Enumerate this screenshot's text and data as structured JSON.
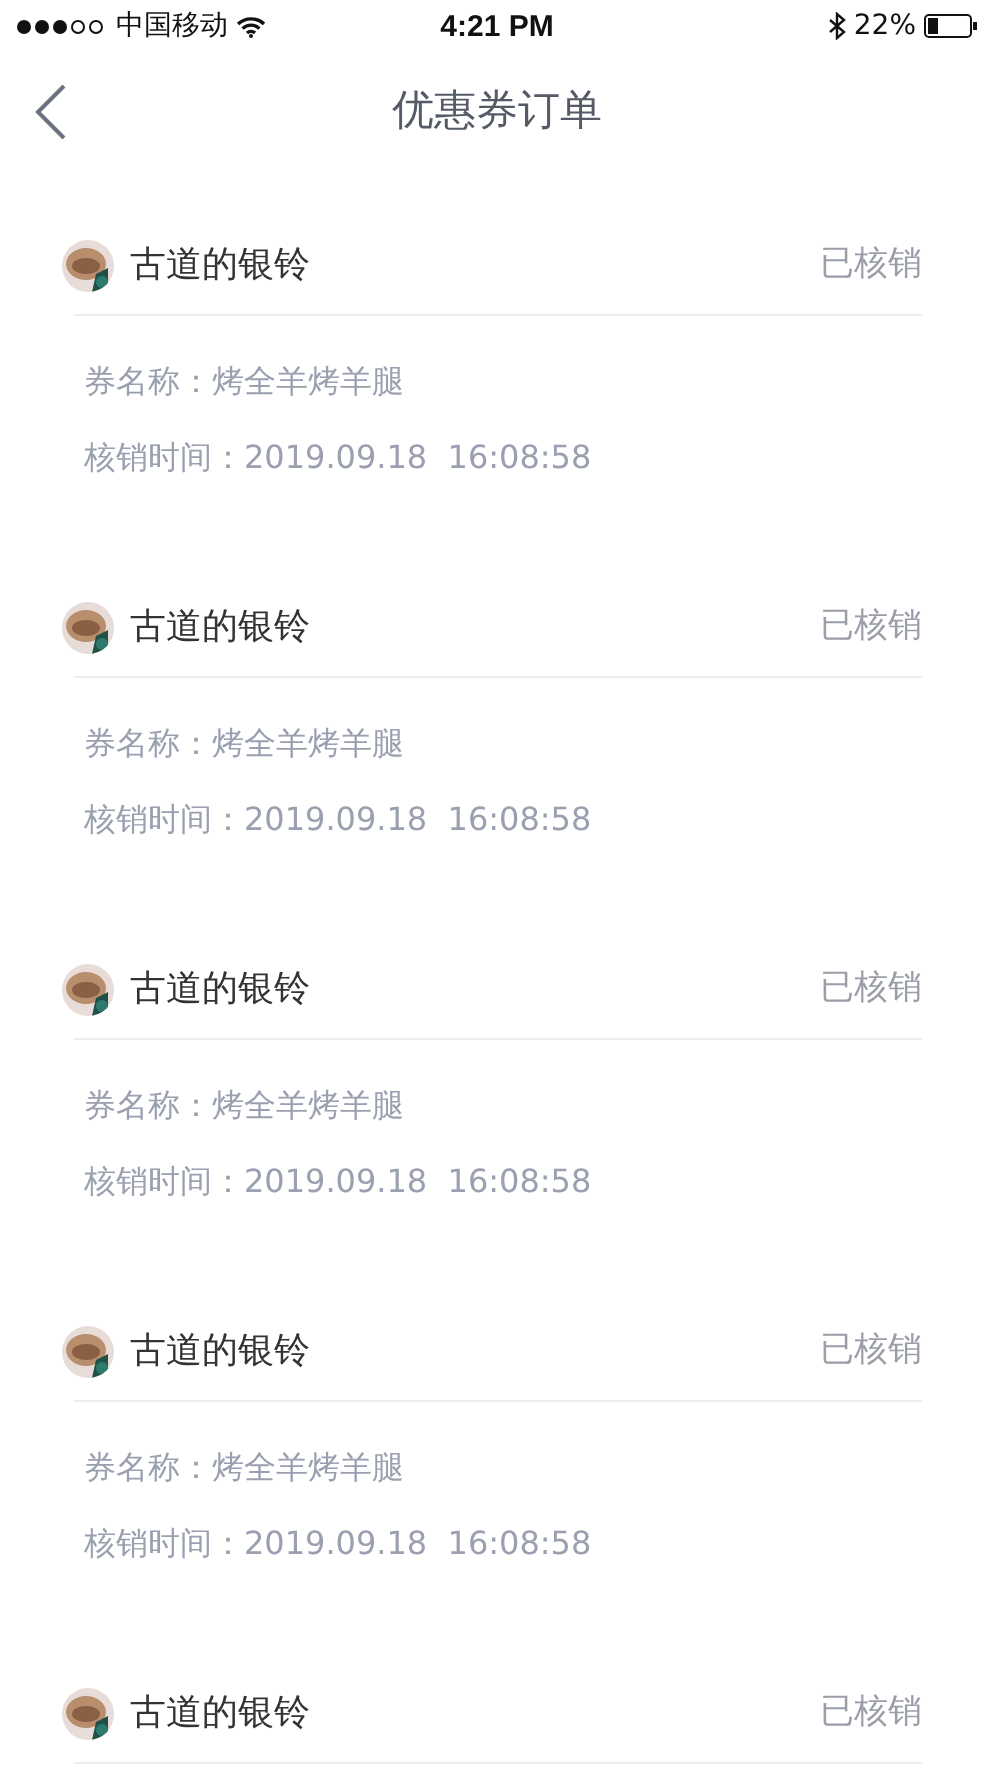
{
  "status_bar": {
    "carrier": "中国移动",
    "time": "4:21 PM",
    "battery_percent": "22%"
  },
  "nav": {
    "title": "优惠券订单"
  },
  "orders": [
    {
      "user": "古道的银铃",
      "status": "已核销",
      "coupon_label": "券名称：",
      "coupon_name": "烤全羊烤羊腿",
      "time_label": "核销时间：",
      "date": "2019.09.18",
      "time": "16:08:58"
    },
    {
      "user": "古道的银铃",
      "status": "已核销",
      "coupon_label": "券名称：",
      "coupon_name": "烤全羊烤羊腿",
      "time_label": "核销时间：",
      "date": "2019.09.18",
      "time": "16:08:58"
    },
    {
      "user": "古道的银铃",
      "status": "已核销",
      "coupon_label": "券名称：",
      "coupon_name": "烤全羊烤羊腿",
      "time_label": "核销时间：",
      "date": "2019.09.18",
      "time": "16:08:58"
    },
    {
      "user": "古道的银铃",
      "status": "已核销",
      "coupon_label": "券名称：",
      "coupon_name": "烤全羊烤羊腿",
      "time_label": "核销时间：",
      "date": "2019.09.18",
      "time": "16:08:58"
    },
    {
      "user": "古道的银铃",
      "status": "已核销"
    }
  ]
}
